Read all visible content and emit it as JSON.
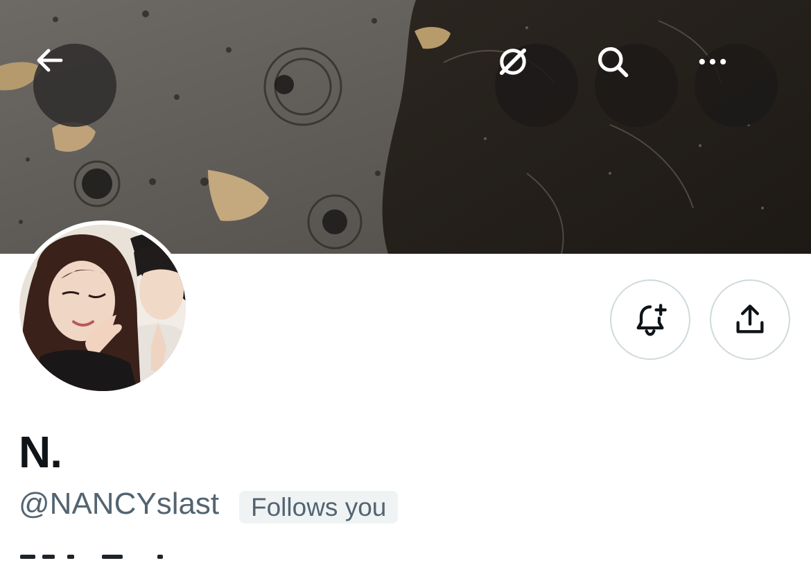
{
  "header": {
    "back_icon": "arrow-left-icon",
    "grok_icon": "grok-icon",
    "search_icon": "search-icon",
    "more_icon": "more-horizontal-icon"
  },
  "profile": {
    "display_name": "N.",
    "handle": "@NANCYslast",
    "follows_you": "Follows you"
  },
  "actions": {
    "notify_icon": "bell-plus-icon",
    "share_icon": "share-icon"
  },
  "colors": {
    "name": "#0f1419",
    "secondary_text": "#536471",
    "badge_bg": "#eff3f4",
    "button_border": "#cfd9de"
  }
}
